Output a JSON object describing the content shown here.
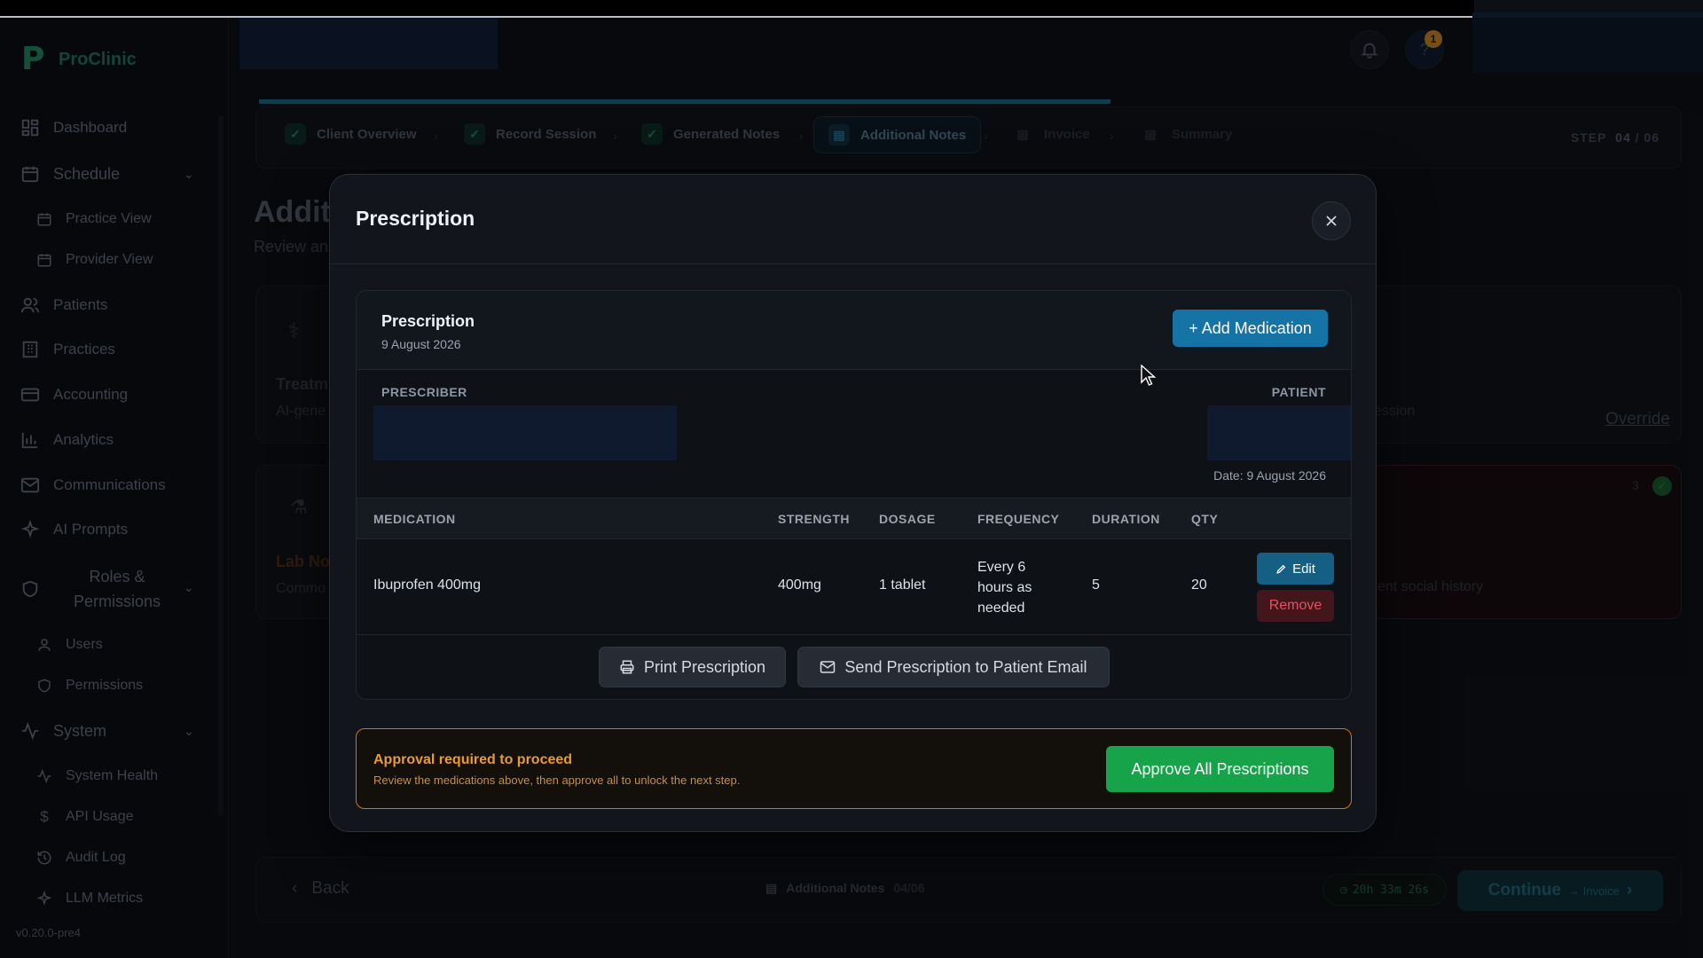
{
  "app": {
    "name": "ProClinic",
    "version": "v0.20.0-pre4"
  },
  "sidebar": {
    "items": [
      {
        "label": "Dashboard",
        "icon": "dashboard-icon"
      },
      {
        "label": "Schedule",
        "icon": "calendar-icon"
      },
      {
        "label": "Practice View",
        "icon": "calendar-icon"
      },
      {
        "label": "Provider View",
        "icon": "calendar-icon"
      },
      {
        "label": "Patients",
        "icon": "users-icon"
      },
      {
        "label": "Practices",
        "icon": "building-icon"
      },
      {
        "label": "Accounting",
        "icon": "credit-card-icon"
      },
      {
        "label": "Analytics",
        "icon": "bar-chart-icon"
      },
      {
        "label": "Communications",
        "icon": "mail-icon"
      },
      {
        "label": "AI Prompts",
        "icon": "sparkles-icon"
      },
      {
        "label": "Roles & Permissions",
        "icon": "shield-icon"
      },
      {
        "label": "Users",
        "icon": "user-icon"
      },
      {
        "label": "Permissions",
        "icon": "shield-icon"
      },
      {
        "label": "System",
        "icon": "activity-icon"
      },
      {
        "label": "System Health",
        "icon": "activity-icon"
      },
      {
        "label": "API Usage",
        "icon": "dollar-icon"
      },
      {
        "label": "Audit Log",
        "icon": "history-icon"
      },
      {
        "label": "LLM Metrics",
        "icon": "sparkles-icon"
      }
    ]
  },
  "header": {
    "notification_count": "1"
  },
  "stepper": {
    "steps": [
      {
        "label": "Client Overview"
      },
      {
        "label": "Record Session"
      },
      {
        "label": "Generated Notes"
      },
      {
        "label": "Additional Notes"
      },
      {
        "label": "Invoice"
      },
      {
        "label": "Summary"
      }
    ],
    "step_label": "STEP",
    "current": "04",
    "total": "06",
    "progress": 0.6
  },
  "background": {
    "title": "Addit",
    "subtitle": "Review an",
    "card1_title": "Treatm",
    "card1_sub": "AI-gene",
    "card2_title": "Lab No",
    "card2_sub": "Commo",
    "right_text1": "ession",
    "right_text2": "tient social history",
    "override": "Override",
    "count": "3"
  },
  "bottom_bar": {
    "back": "Back",
    "status_label": "Additional Notes",
    "status_count": "04/06",
    "timer": "20h 33m 26s",
    "continue": "Continue",
    "continue_next": "→ Invoice"
  },
  "modal": {
    "title": "Prescription",
    "card": {
      "title": "Prescription",
      "date": "9 August 2026",
      "add_button": "+ Add Medication",
      "prescriber_label": "PRESCRIBER",
      "patient_label": "PATIENT",
      "date_line": "Date: 9 August 2026"
    },
    "table": {
      "headers": [
        "MEDICATION",
        "STRENGTH",
        "DOSAGE",
        "FREQUENCY",
        "DURATION",
        "QTY"
      ],
      "rows": [
        {
          "medication": "Ibuprofen 400mg",
          "strength": "400mg",
          "dosage": "1 tablet",
          "frequency": "Every 6 hours as needed",
          "duration": "5",
          "qty": "20"
        }
      ],
      "edit": "Edit",
      "remove": "Remove"
    },
    "print_button": "Print Prescription",
    "email_button": "Send Prescription to Patient Email",
    "approval": {
      "title": "Approval required to proceed",
      "subtitle": "Review the medications above, then approve all to unlock the next step.",
      "button": "Approve All Prescriptions"
    }
  },
  "colors": {
    "accent": "#1673a6",
    "success": "#16a34a",
    "warning": "#c77717",
    "danger": "#e05260"
  }
}
